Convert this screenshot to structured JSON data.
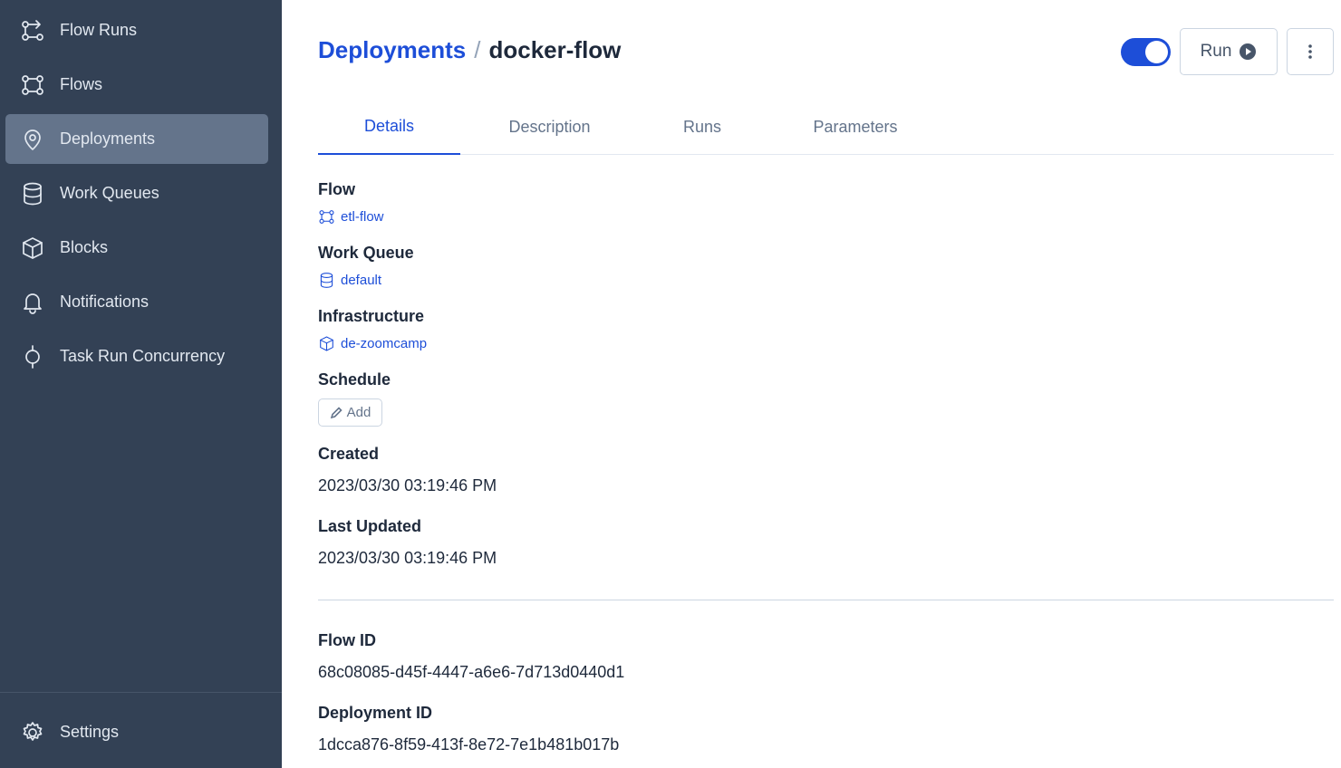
{
  "sidebar": {
    "items": [
      {
        "label": "Flow Runs",
        "icon": "flow-runs-icon"
      },
      {
        "label": "Flows",
        "icon": "flows-icon"
      },
      {
        "label": "Deployments",
        "icon": "deployments-icon",
        "active": true
      },
      {
        "label": "Work Queues",
        "icon": "database-icon"
      },
      {
        "label": "Blocks",
        "icon": "cube-icon"
      },
      {
        "label": "Notifications",
        "icon": "bell-icon"
      },
      {
        "label": "Task Run Concurrency",
        "icon": "concurrency-icon"
      }
    ],
    "footer": {
      "label": "Settings",
      "icon": "gear-icon"
    }
  },
  "header": {
    "breadcrumb_parent": "Deployments",
    "breadcrumb_separator": "/",
    "breadcrumb_current": "docker-flow",
    "schedule_toggle_on": true,
    "run_label": "Run"
  },
  "tabs": [
    {
      "label": "Details",
      "active": true
    },
    {
      "label": "Description"
    },
    {
      "label": "Runs"
    },
    {
      "label": "Parameters"
    }
  ],
  "details": {
    "flow_label": "Flow",
    "flow_value": "etl-flow",
    "work_queue_label": "Work Queue",
    "work_queue_value": "default",
    "infrastructure_label": "Infrastructure",
    "infrastructure_value": "de-zoomcamp",
    "schedule_label": "Schedule",
    "schedule_add_label": "Add",
    "created_label": "Created",
    "created_value": "2023/03/30 03:19:46 PM",
    "last_updated_label": "Last Updated",
    "last_updated_value": "2023/03/30 03:19:46 PM",
    "flow_id_label": "Flow ID",
    "flow_id_value": "68c08085-d45f-4447-a6e6-7d713d0440d1",
    "deployment_id_label": "Deployment ID",
    "deployment_id_value": "1dcca876-8f59-413f-8e72-7e1b481b017b"
  },
  "colors": {
    "sidebar_bg": "#334155",
    "sidebar_active": "#64748b",
    "accent": "#1d4ed8",
    "text": "#1e293b"
  }
}
